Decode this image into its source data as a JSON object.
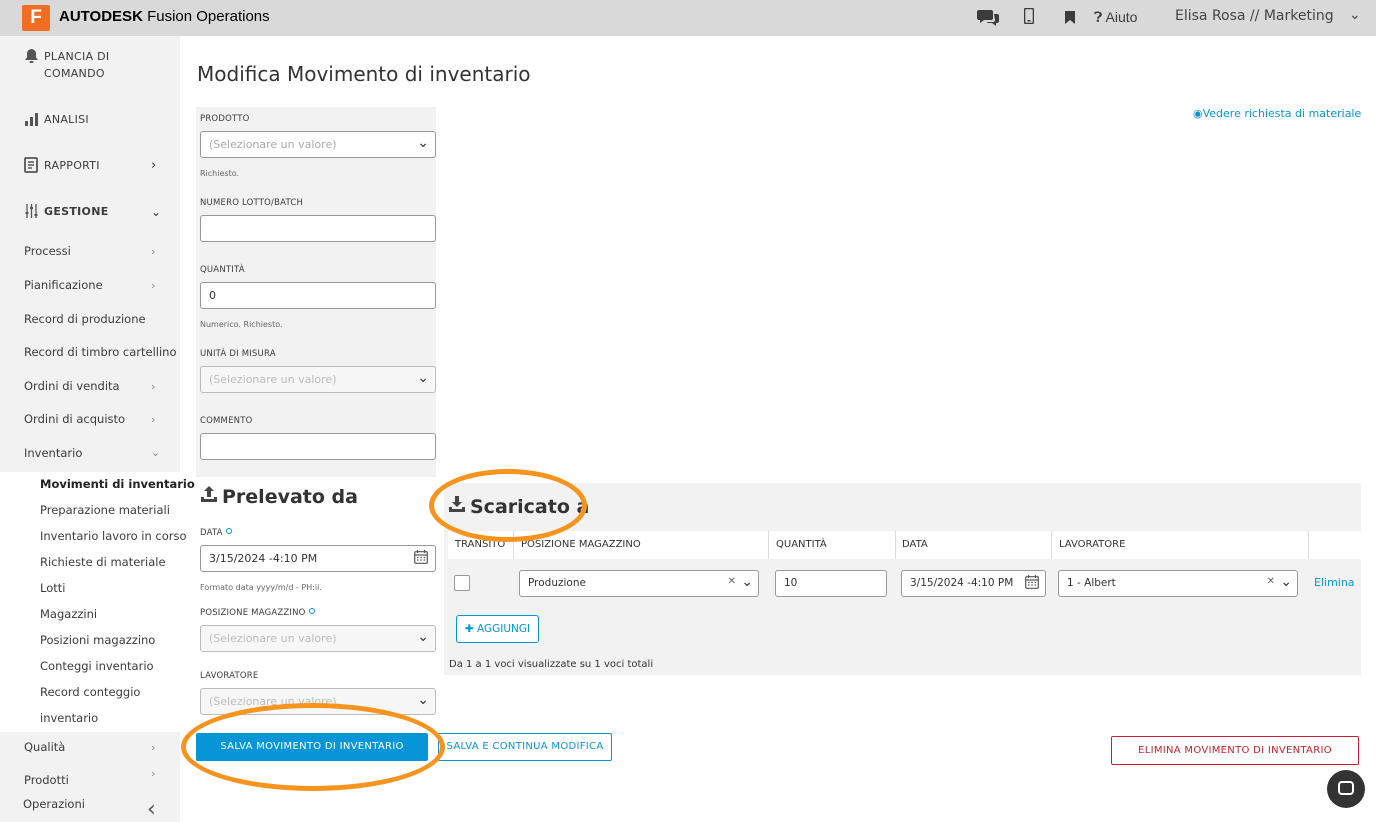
{
  "topbar": {
    "logo_letter": "F",
    "brand": "AUTODESK",
    "product": "Fusion Operations",
    "chat_icon": "chat-icon",
    "mobile_icon": "mobile-icon",
    "bookmark_icon": "bookmark-icon",
    "help_label": "Aiuto",
    "user_label": "Elisa Rosa // Marketing"
  },
  "sidebar": {
    "dashboard": "PLANCIA DI COMANDO",
    "analytics": "ANALISI",
    "reports": "RAPPORTI",
    "management": "GESTIONE",
    "items": [
      {
        "label": "Processi"
      },
      {
        "label": "Pianificazione"
      },
      {
        "label": "Record di produzione"
      },
      {
        "label": "Record di timbro cartellino"
      },
      {
        "label": "Ordini di vendita"
      },
      {
        "label": "Ordini di acquisto"
      },
      {
        "label": "Inventario"
      }
    ],
    "inventory_items": [
      {
        "label": "Movimenti di inventario"
      },
      {
        "label": "Preparazione materiali"
      },
      {
        "label": "Inventario lavoro in corso"
      },
      {
        "label": "Richieste di materiale"
      },
      {
        "label": "Lotti"
      },
      {
        "label": "Magazzini"
      },
      {
        "label": "Posizioni magazzino"
      },
      {
        "label": "Conteggi inventario"
      },
      {
        "label": "Record conteggio"
      },
      {
        "label": "inventario"
      }
    ],
    "quality": "Qualità",
    "products": "Prodotti",
    "operations": "Operazioni"
  },
  "page": {
    "title": "Modifica Movimento di inventario",
    "material_request_link": "Vedere richiesta di materiale"
  },
  "form": {
    "product_label": "PRODOTTO",
    "product_placeholder": "(Selezionare un valore)",
    "product_help": "Richiesto.",
    "batch_label": "NUMERO LOTTO/BATCH",
    "batch_value": "",
    "quantity_label": "QUANTITÀ",
    "quantity_value": "0",
    "quantity_help": "Numerico. Richiesto.",
    "uom_label": "UNITÀ DI MISURA",
    "uom_placeholder": "(Selezionare un valore)",
    "comment_label": "COMMENTO",
    "comment_value": ""
  },
  "source": {
    "title": "Prelevato da",
    "date_label": "DATA",
    "date_value": "3/15/2024 -4:10 PM",
    "date_help": "Formato data yyyy/m/d - PH:ii.",
    "location_label": "POSIZIONE MAGAZZINO",
    "location_placeholder": "(Selezionare un valore)",
    "worker_label": "LAVORATORE",
    "worker_placeholder": "(Selezionare un valore)"
  },
  "destination": {
    "title": "Scaricato a",
    "columns": [
      "TRANSITO",
      "POSIZIONE MAGAZZINO",
      "QUANTITÀ",
      "DATA",
      "LAVORATORE"
    ],
    "row": {
      "location": "Produzione",
      "quantity": "10",
      "date": "3/15/2024 -4:10 PM",
      "worker": "1 - Albert",
      "delete_label": "Elimina"
    },
    "add_label": "AGGIUNGI",
    "paging": "Da 1 a 1 voci visualizzate su 1 voci totali"
  },
  "actions": {
    "save": "SALVA MOVIMENTO DI INVENTARIO",
    "save_continue": "SALVA E CONTINUA MODIFICA",
    "delete": "ELIMINA MOVIMENTO DI INVENTARIO"
  },
  "colors": {
    "accent": "#0696d7",
    "danger": "#c4232f",
    "highlight_ring": "#f7941d",
    "brand": "#f26d21"
  }
}
